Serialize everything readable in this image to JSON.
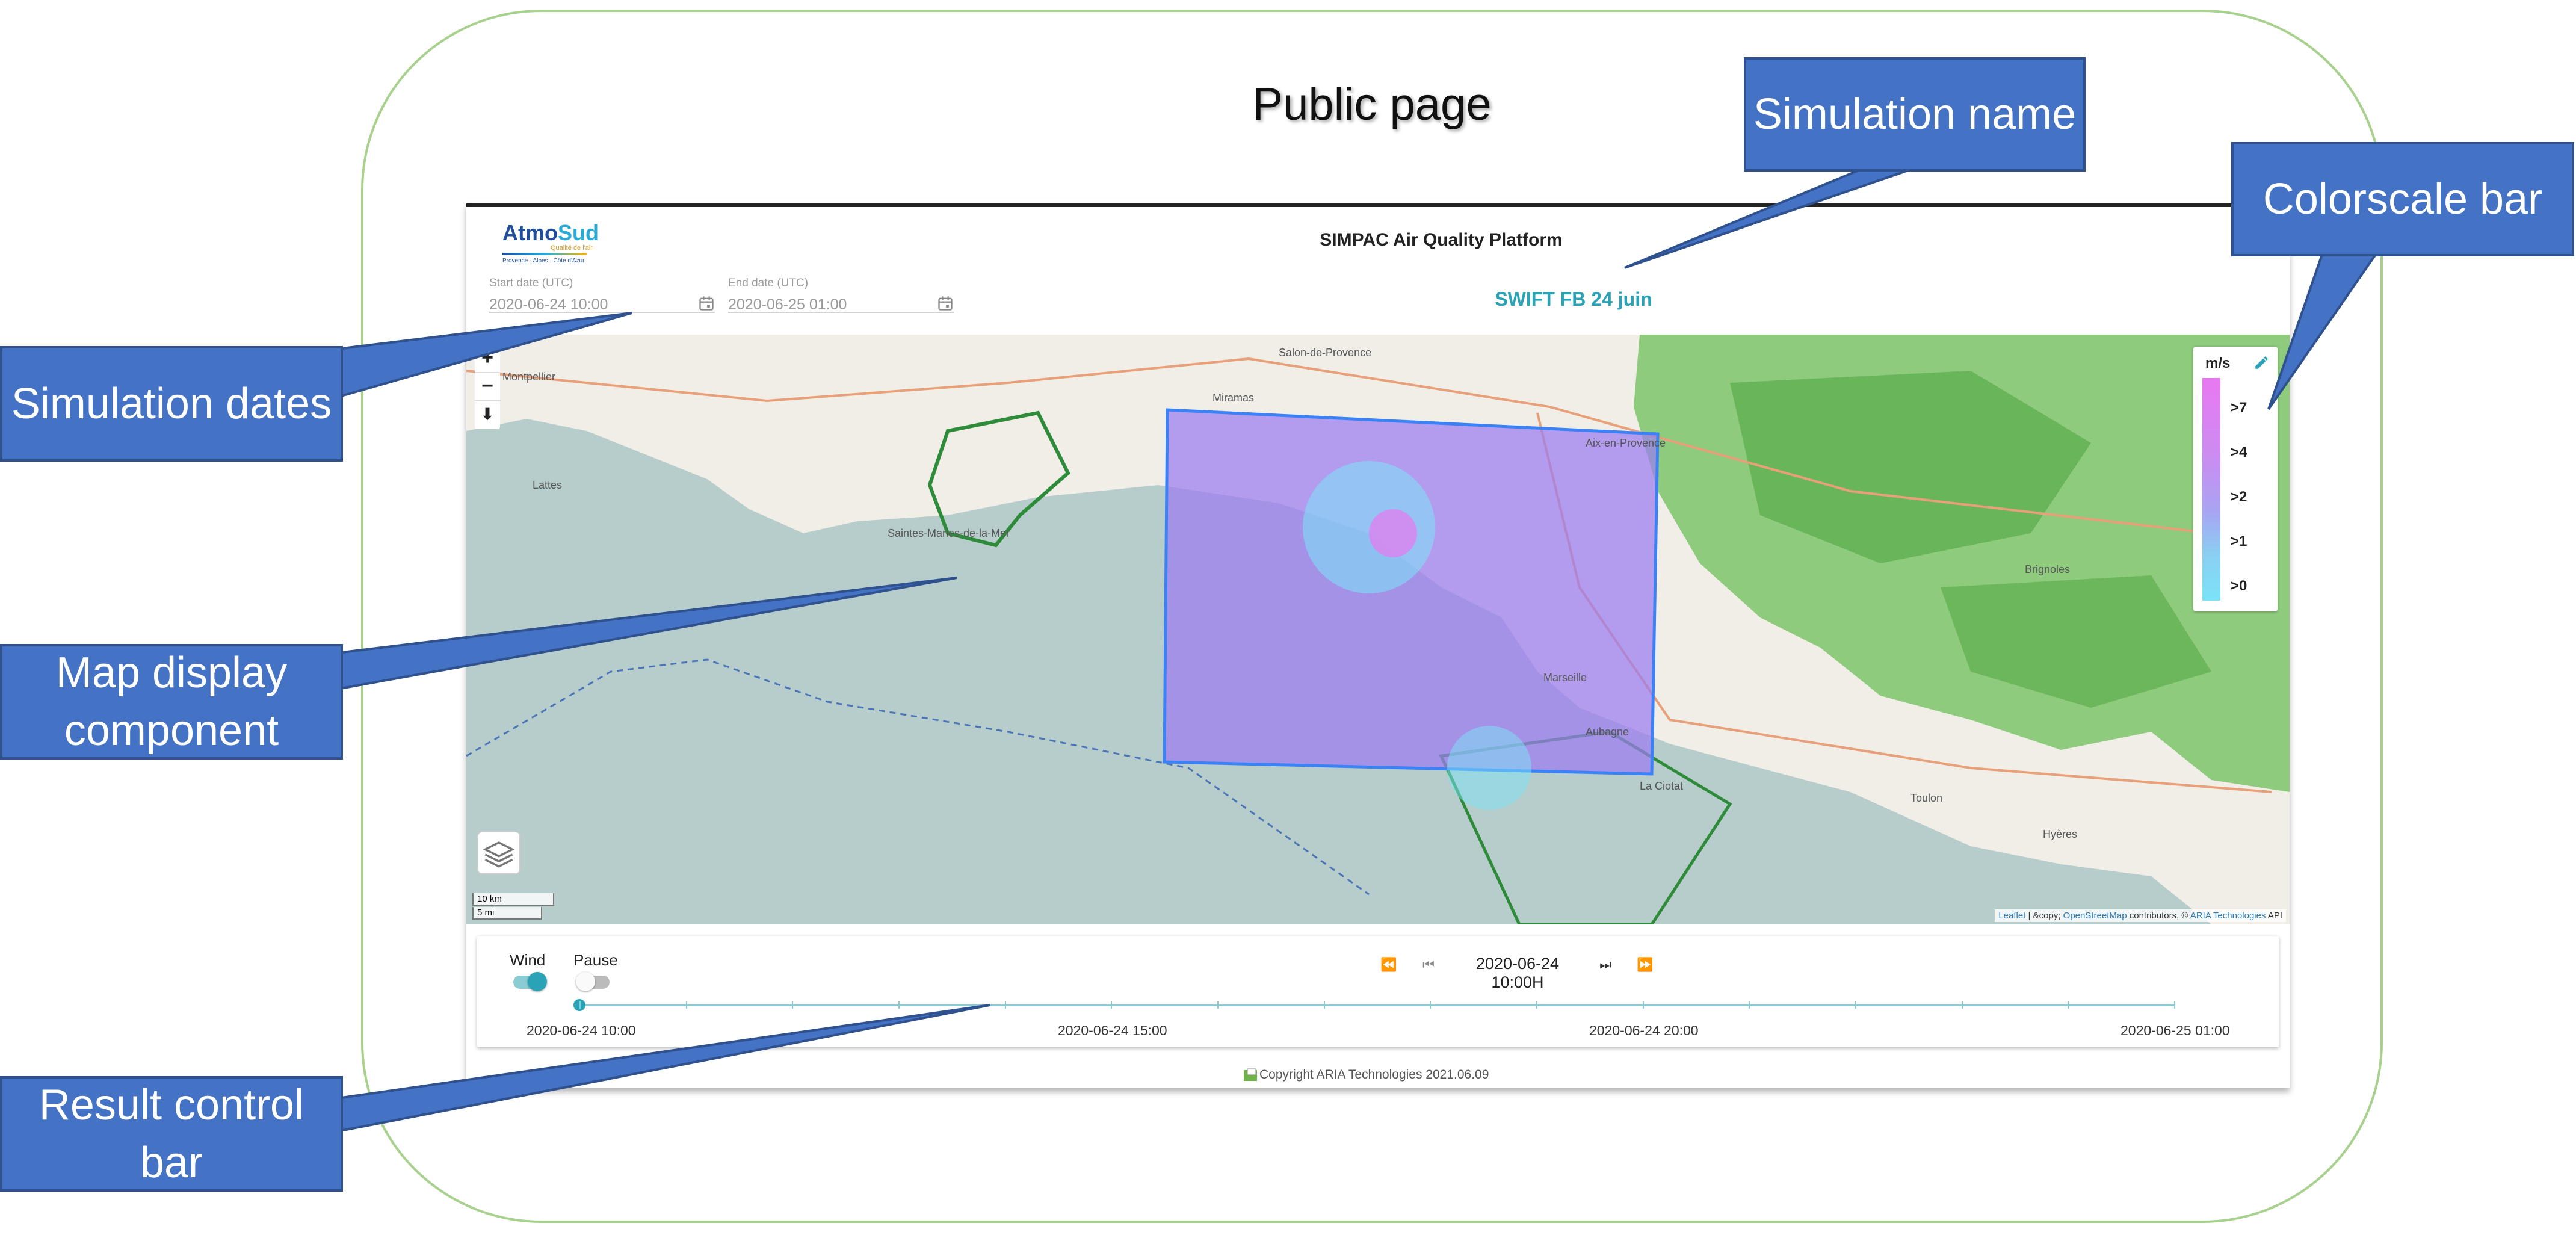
{
  "page": {
    "heading": "Public page"
  },
  "app": {
    "logo": {
      "brand_a": "Atmo",
      "brand_b": "Sud",
      "tagline": "Qualité de l'air",
      "region": "Provence · Alpes · Côte d'Azur"
    },
    "title": "SIMPAC Air Quality Platform",
    "simulation_name": "SWIFT FB 24 juin",
    "start_date": {
      "label": "Start date (UTC)",
      "value": "2020-06-24 10:00"
    },
    "end_date": {
      "label": "End date (UTC)",
      "value": "2020-06-25 01:00"
    }
  },
  "map": {
    "zoom_in": "+",
    "zoom_out": "−",
    "download": "⬇",
    "scale_km": "10 km",
    "scale_mi": "5 mi",
    "attribution": {
      "leaflet": "Leaflet",
      "sep1": " | &copy; ",
      "osm": "OpenStreetMap",
      "sep2": " contributors, © ",
      "aria": "ARIA Technologies",
      "api": " API"
    },
    "places": [
      {
        "name": "Aix-en-Provence"
      },
      {
        "name": "Marseille"
      },
      {
        "name": "Montpellier"
      },
      {
        "name": "Toulon"
      },
      {
        "name": "La Ciotat"
      },
      {
        "name": "Aubagne"
      },
      {
        "name": "Brignoles"
      },
      {
        "name": "Miramas"
      },
      {
        "name": "Lattes"
      },
      {
        "name": "Saintes-Maries-de-la-Mer"
      },
      {
        "name": "Hyères"
      },
      {
        "name": "Salon-de-Provence"
      }
    ],
    "colors": {
      "sea": "#b7cdcb",
      "land": "#f2efe9",
      "forest": "#6dbf5b",
      "overlay": "#9b7cf0",
      "domain_border": "#3b82f6",
      "marine_park": "#2e8b3a"
    }
  },
  "colorscale": {
    "unit": "m/s",
    "labels": [
      ">7",
      ">4",
      ">2",
      ">1",
      ">0"
    ]
  },
  "controls": {
    "wind_label": "Wind",
    "pause_label": "Pause",
    "current_time": "2020-06-24 10:00H",
    "timeline_labels": [
      "2020-06-24 10:00",
      "2020-06-24 15:00",
      "2020-06-24 20:00",
      "2020-06-25 01:00"
    ]
  },
  "footer": {
    "copyright": "Copyright ARIA Technologies 2021.06.09"
  },
  "callouts": {
    "simulation_name": "Simulation name",
    "colorscale_bar": "Colorscale bar",
    "simulation_dates": "Simulation dates",
    "map_display": "Map display component",
    "result_control": "Result control bar"
  }
}
